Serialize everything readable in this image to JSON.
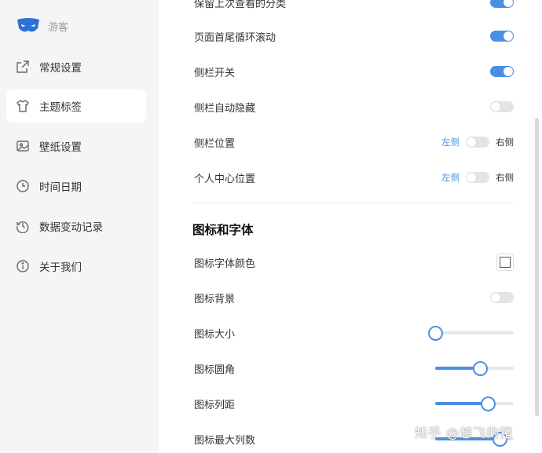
{
  "brand": {
    "name": "游客"
  },
  "sidebar": {
    "items": [
      {
        "label": "常规设置",
        "icon": "external-link-icon",
        "active": false
      },
      {
        "label": "主题标签",
        "icon": "shirt-icon",
        "active": true
      },
      {
        "label": "壁纸设置",
        "icon": "image-icon",
        "active": false
      },
      {
        "label": "时间日期",
        "icon": "clock-icon",
        "active": false
      },
      {
        "label": "数据变动记录",
        "icon": "history-icon",
        "active": false
      },
      {
        "label": "关于我们",
        "icon": "info-icon",
        "active": false
      }
    ]
  },
  "settings": {
    "partial_top_label": "保留上次查看的分类",
    "page_loop_scroll": "页面首尾循环滚动",
    "sidebar_toggle": "侧栏开关",
    "sidebar_autohide": "侧栏自动隐藏",
    "sidebar_position": "侧栏位置",
    "profile_position": "个人中心位置",
    "left": "左侧",
    "right": "右侧"
  },
  "icon_font": {
    "section_title": "图标和字体",
    "font_color": "图标字体颜色",
    "background": "图标背景",
    "size": "图标大小",
    "radius": "图标圆角",
    "column_gap": "图标列距",
    "max_columns": "图标最大列数"
  },
  "toggles": {
    "partial_top": true,
    "page_loop_scroll": true,
    "sidebar_toggle": true,
    "sidebar_autohide": false,
    "sidebar_position_right": false,
    "profile_position_right": false,
    "icon_background": false
  },
  "sliders": {
    "icon_size": 0,
    "icon_radius": 0.57,
    "icon_column_gap": 0.67,
    "icon_max_columns": 0.82
  },
  "watermark": "知乎 @想飞的猪",
  "colors": {
    "accent": "#4a90e2",
    "sidebar_bg": "#f4f5f7"
  }
}
